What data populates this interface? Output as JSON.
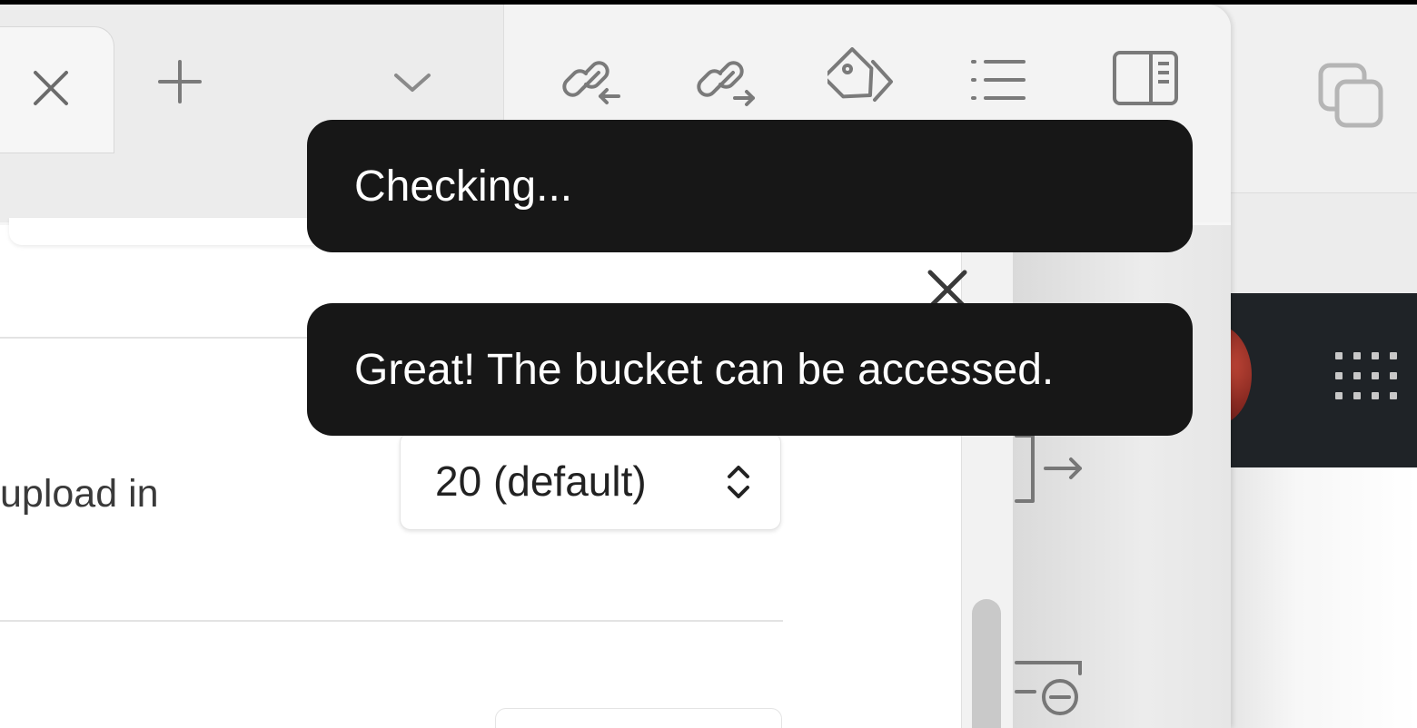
{
  "tabs": {
    "close_icon": "close-icon",
    "new_tab_icon": "plus-icon",
    "tab_list_icon": "chevron-down-icon"
  },
  "toolbar": {
    "buttons": [
      {
        "name": "backlinks-button",
        "icon": "link-incoming-icon"
      },
      {
        "name": "outgoing-links-button",
        "icon": "link-outgoing-icon"
      },
      {
        "name": "tags-button",
        "icon": "tags-icon"
      },
      {
        "name": "outline-button",
        "icon": "list-icon"
      },
      {
        "name": "toggle-sidebar-button",
        "icon": "sidebar-right-icon"
      }
    ]
  },
  "settings": {
    "label_fragment": "upload in",
    "concurrency": {
      "value": "20 (default)"
    }
  },
  "notices": [
    {
      "text": "Checking..."
    },
    {
      "text": "Great! The bucket can be accessed."
    }
  ],
  "colors": {
    "toast_background": "#171717",
    "toast_text": "#ffffff"
  }
}
